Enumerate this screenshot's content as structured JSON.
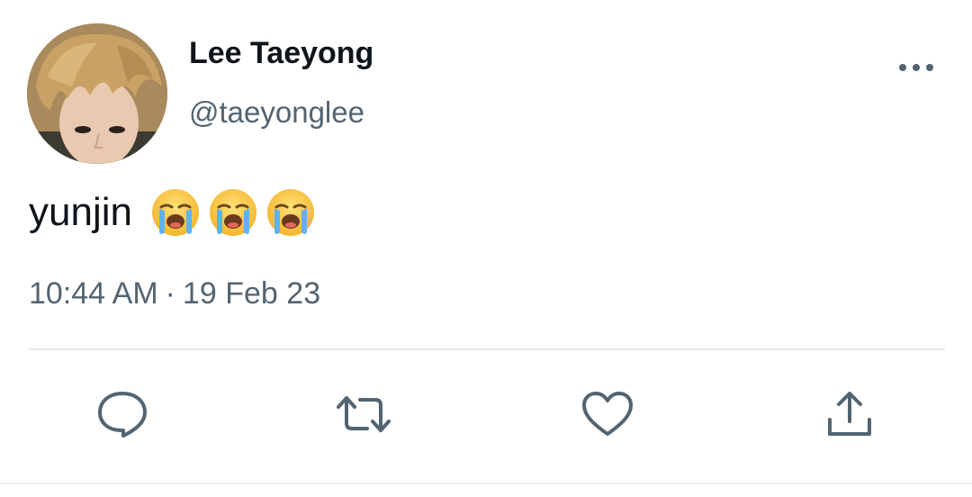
{
  "tweet": {
    "display_name": "Lee Taeyong",
    "handle": "@taeyonglee",
    "text": "yunjin",
    "emojis": [
      "loudly-crying-face",
      "loudly-crying-face",
      "loudly-crying-face"
    ],
    "time": "10:44 AM",
    "separator": "·",
    "date": "19 Feb 23"
  },
  "icons": {
    "more": "more-horizontal-icon",
    "reply": "reply-icon",
    "retweet": "retweet-icon",
    "like": "heart-icon",
    "share": "share-icon"
  },
  "colors": {
    "text_primary": "#0f1419",
    "text_secondary": "#536471",
    "icon": "#536471",
    "divider": "#e6eaed"
  }
}
